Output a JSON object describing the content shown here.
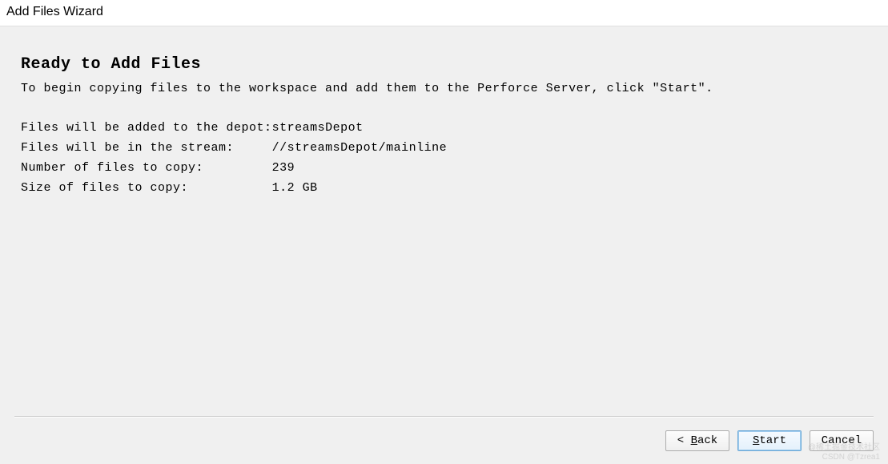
{
  "window": {
    "title": "Add Files Wizard"
  },
  "page": {
    "heading": "Ready to Add Files",
    "description": "To begin copying files to the workspace and add them to the Perforce Server, click \"Start\"."
  },
  "info": {
    "depot_label": "Files will be added to the depot:",
    "depot_value": "streamsDepot",
    "stream_label": "Files will be in the stream:",
    "stream_value": "//streamsDepot/mainline",
    "count_label": "Number of files to copy:",
    "count_value": "239",
    "size_label": "Size of files to copy:",
    "size_value": "1.2 GB"
  },
  "buttons": {
    "back": "Back",
    "back_mnemonic": "B",
    "back_rest": "ack",
    "start": "Start",
    "start_mnemonic": "S",
    "start_rest": "tart",
    "cancel": "Cancel"
  },
  "watermark": {
    "line1": "@稀土掘金技术社区",
    "line2": "CSDN @Tzrea1"
  }
}
